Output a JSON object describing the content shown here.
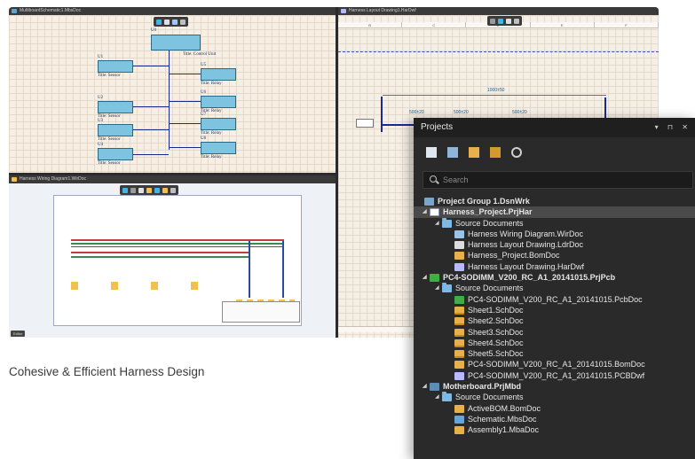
{
  "panes": {
    "schematic_title": "MultiboardSchematic1.MbsDoc",
    "layout_title": "Harness Layout Drawing1.HarDwf",
    "wiring_title": "Harness Wiring Diagram1.WirDoc",
    "editor_tab": "Editor"
  },
  "schematic": {
    "u0_ref": "U0",
    "u0_title": "Title: Control Unit",
    "u1_ref": "U1",
    "u2_ref": "U2",
    "u3_ref": "U3",
    "u4_ref": "U4",
    "sensor_title": "Title: Sensor",
    "relay_title": "Title: Relay",
    "u5_ref": "U5",
    "u6_ref": "U6",
    "u7_ref": "U7",
    "u8_ref": "U8"
  },
  "layout": {
    "ruler_letters": [
      "B",
      "C",
      "D",
      "E",
      "F"
    ],
    "dim_1000": "1000±50",
    "dim_500a": "500±20",
    "dim_500b": "500±20",
    "dim_500c": "500±20"
  },
  "caption": "Cohesive & Efficient Harness Design",
  "projects": {
    "title": "Projects",
    "controls": "▾ ⊓ ✕",
    "search_placeholder": "Search",
    "tree": [
      {
        "label": "Project Group 1.DsnWrk",
        "indent": 0,
        "icon": "grp",
        "arrow": "",
        "bold": true,
        "sel": false
      },
      {
        "label": "Harness_Project.PrjHar",
        "indent": 1,
        "icon": "har",
        "arrow": "◢",
        "bold": true,
        "sel": true
      },
      {
        "label": "Source Documents",
        "indent": 2,
        "icon": "folder",
        "arrow": "◢",
        "bold": false,
        "sel": false
      },
      {
        "label": "Harness Wiring Diagram.WirDoc",
        "indent": 3,
        "icon": "wir",
        "arrow": "",
        "bold": false,
        "sel": false
      },
      {
        "label": "Harness Layout Drawing.LdrDoc",
        "indent": 3,
        "icon": "ldr",
        "arrow": "",
        "bold": false,
        "sel": false
      },
      {
        "label": "Harness_Project.BomDoc",
        "indent": 3,
        "icon": "bom",
        "arrow": "",
        "bold": false,
        "sel": false
      },
      {
        "label": "Harness Layout Drawing.HarDwf",
        "indent": 3,
        "icon": "dwf",
        "arrow": "",
        "bold": false,
        "sel": false
      },
      {
        "label": "PC4-SODIMM_V200_RC_A1_20141015.PrjPcb",
        "indent": 1,
        "icon": "pcb",
        "arrow": "◢",
        "bold": true,
        "sel": false
      },
      {
        "label": "Source Documents",
        "indent": 2,
        "icon": "folder",
        "arrow": "◢",
        "bold": false,
        "sel": false
      },
      {
        "label": "PC4-SODIMM_V200_RC_A1_20141015.PcbDoc",
        "indent": 3,
        "icon": "pcb",
        "arrow": "",
        "bold": false,
        "sel": false
      },
      {
        "label": "Sheet1.SchDoc",
        "indent": 3,
        "icon": "sch",
        "arrow": "",
        "bold": false,
        "sel": false
      },
      {
        "label": "Sheet2.SchDoc",
        "indent": 3,
        "icon": "sch",
        "arrow": "",
        "bold": false,
        "sel": false
      },
      {
        "label": "Sheet3.SchDoc",
        "indent": 3,
        "icon": "sch",
        "arrow": "",
        "bold": false,
        "sel": false
      },
      {
        "label": "Sheet4.SchDoc",
        "indent": 3,
        "icon": "sch",
        "arrow": "",
        "bold": false,
        "sel": false
      },
      {
        "label": "Sheet5.SchDoc",
        "indent": 3,
        "icon": "sch",
        "arrow": "",
        "bold": false,
        "sel": false
      },
      {
        "label": "PC4-SODIMM_V200_RC_A1_20141015.BomDoc",
        "indent": 3,
        "icon": "bom",
        "arrow": "",
        "bold": false,
        "sel": false
      },
      {
        "label": "PC4-SODIMM_V200_RC_A1_20141015.PCBDwf",
        "indent": 3,
        "icon": "dwf",
        "arrow": "",
        "bold": false,
        "sel": false
      },
      {
        "label": "Motherboard.PrjMbd",
        "indent": 1,
        "icon": "mbd",
        "arrow": "◢",
        "bold": true,
        "sel": false
      },
      {
        "label": "Source Documents",
        "indent": 2,
        "icon": "folder",
        "arrow": "◢",
        "bold": false,
        "sel": false
      },
      {
        "label": "ActiveBOM.BomDoc",
        "indent": 3,
        "icon": "bom",
        "arrow": "",
        "bold": false,
        "sel": false
      },
      {
        "label": "Schematic.MbsDoc",
        "indent": 3,
        "icon": "mbs",
        "arrow": "",
        "bold": false,
        "sel": false
      },
      {
        "label": "Assembly1.MbaDoc",
        "indent": 3,
        "icon": "mba",
        "arrow": "",
        "bold": false,
        "sel": false
      }
    ]
  },
  "colors": {
    "panel_bg": "#2a2a2a",
    "selected_row": "#4a4a4a",
    "wire_blue": "#1b2a8a",
    "block_cyan": "#7ec3df"
  }
}
